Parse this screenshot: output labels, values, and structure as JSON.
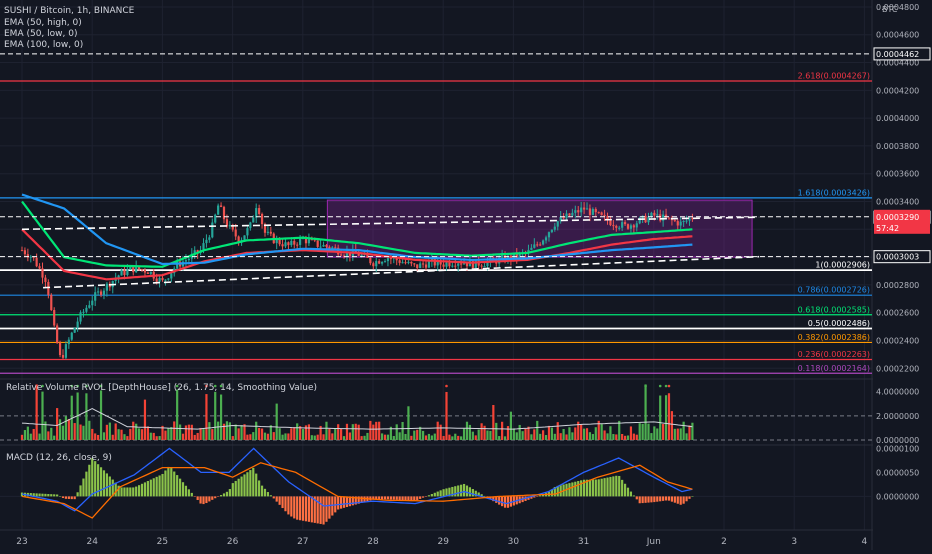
{
  "colors": {
    "background": "#131722",
    "grid": "#1e2230",
    "separator": "#2a2e39",
    "axis_text": "#b2b5be",
    "candle_up": "#26a69a",
    "candle_down": "#ef5350",
    "ema50_high": "#00e676",
    "ema50_low": "#f23645",
    "ema100_low": "#2196f3",
    "range_box": "#9c27b0",
    "vol_up": "#4caf50",
    "vol_down": "#f44336",
    "macd_line": "#2962ff",
    "signal_line": "#ff6d00"
  },
  "header": {
    "title": "SUSHI / Bitcoin, 1h, BINANCE",
    "indicators": [
      "EMA (50, high, 0)",
      "EMA (50, low, 0)",
      "EMA (100, low, 0)"
    ]
  },
  "price_axis": {
    "unit": "BTC",
    "ticks": [
      "0.0004800",
      "0.0004600",
      "0.0004400",
      "0.0004200",
      "0.0004000",
      "0.0003800",
      "0.0003600",
      "0.0003400",
      "0.0003200",
      "0.0003000",
      "0.0002800",
      "0.0002600",
      "0.0002400",
      "0.0002200"
    ],
    "last_price_label": "0.0003290",
    "countdown_label": "57:42",
    "boxed_labels": [
      "0.0004462",
      "0.0003287",
      "0.0003003"
    ]
  },
  "fib_levels": [
    {
      "label": "2.618(0.0004267)",
      "color": "#f23645"
    },
    {
      "label": "1.618(0.0003426)",
      "color": "#2196f3"
    },
    {
      "label": "1(0.0002906)",
      "color": "#ffffff"
    },
    {
      "label": "0.786(0.0002726)",
      "color": "#1e88e5"
    },
    {
      "label": "0.618(0.0002585)",
      "color": "#00e676"
    },
    {
      "label": "0.5(0.0002486)",
      "color": "#ffffff"
    },
    {
      "label": "0.382(0.0002386)",
      "color": "#ff9800"
    },
    {
      "label": "0.236(0.0002263)",
      "color": "#f23645"
    },
    {
      "label": "0.118(0.0002164)",
      "color": "#ab47bc"
    }
  ],
  "rvol": {
    "title": "Relative Volume RVOL [DepthHouse] (26, 1.75, 14, Smoothing Value)",
    "ticks": [
      "4.0000000",
      "2.0000000",
      "0.0000000"
    ]
  },
  "macd": {
    "title": "MACD (12, 26, close, 9)",
    "ticks": [
      "0.0000100",
      "0.0000050",
      "0.0000000"
    ]
  },
  "time_axis": {
    "labels": [
      "23",
      "24",
      "25",
      "26",
      "27",
      "28",
      "29",
      "30",
      "31",
      "Jun",
      "2",
      "3",
      "4"
    ]
  },
  "chart_data": {
    "type": "candlestick",
    "symbol": "SUSHI / Bitcoin",
    "interval": "1h",
    "exchange": "BINANCE",
    "y_unit": "BTC",
    "ylim": [
      0.000213,
      0.000485
    ],
    "x_categories": [
      "23",
      "24",
      "25",
      "26",
      "27",
      "28",
      "29",
      "30",
      "31",
      "Jun",
      "2",
      "3",
      "4"
    ],
    "last_price": 0.000329,
    "price_path": [
      [
        0,
        0.000305
      ],
      [
        0.15,
        0.0003
      ],
      [
        0.35,
        0.000283
      ],
      [
        0.45,
        0.00025
      ],
      [
        0.55,
        0.000226
      ],
      [
        0.65,
        0.000238
      ],
      [
        0.8,
        0.000255
      ],
      [
        1.0,
        0.00027
      ],
      [
        1.2,
        0.000279
      ],
      [
        1.4,
        0.000288
      ],
      [
        1.6,
        0.000292
      ],
      [
        1.8,
        0.00029
      ],
      [
        2.0,
        0.000282
      ],
      [
        2.2,
        0.000294
      ],
      [
        2.4,
        0.0003
      ],
      [
        2.55,
        0.000305
      ],
      [
        2.7,
        0.00032
      ],
      [
        2.8,
        0.000338
      ],
      [
        2.9,
        0.000325
      ],
      [
        3.0,
        0.000318
      ],
      [
        3.1,
        0.000312
      ],
      [
        3.25,
        0.000322
      ],
      [
        3.35,
        0.00034
      ],
      [
        3.45,
        0.000318
      ],
      [
        3.6,
        0.000312
      ],
      [
        3.8,
        0.000308
      ],
      [
        4.0,
        0.000313
      ],
      [
        4.2,
        0.000309
      ],
      [
        4.4,
        0.000307
      ],
      [
        4.6,
        0.000303
      ],
      [
        4.8,
        0.000302
      ],
      [
        5.0,
        0.000296
      ],
      [
        5.2,
        0.0003
      ],
      [
        5.4,
        0.000297
      ],
      [
        5.6,
        0.000293
      ],
      [
        5.8,
        0.000296
      ],
      [
        6.0,
        0.000295
      ],
      [
        6.2,
        0.000297
      ],
      [
        6.4,
        0.000295
      ],
      [
        6.6,
        0.000296
      ],
      [
        6.8,
        0.000298
      ],
      [
        7.0,
        0.0003
      ],
      [
        7.2,
        0.000303
      ],
      [
        7.4,
        0.000312
      ],
      [
        7.6,
        0.000325
      ],
      [
        7.8,
        0.00033
      ],
      [
        8.0,
        0.000335
      ],
      [
        8.2,
        0.00033
      ],
      [
        8.4,
        0.000325
      ],
      [
        8.6,
        0.000322
      ],
      [
        8.8,
        0.000326
      ],
      [
        9.0,
        0.00033
      ],
      [
        9.2,
        0.000327
      ],
      [
        9.4,
        0.000324
      ],
      [
        9.55,
        0.000329
      ]
    ],
    "ema_series": [
      {
        "name": "EMA (50, high, 0)",
        "values": [
          [
            0,
            0.00034
          ],
          [
            0.6,
            0.0003
          ],
          [
            1.2,
            0.000294
          ],
          [
            2.0,
            0.000293
          ],
          [
            2.6,
            0.000305
          ],
          [
            3.2,
            0.000312
          ],
          [
            4.0,
            0.000314
          ],
          [
            4.8,
            0.00031
          ],
          [
            5.6,
            0.000303
          ],
          [
            6.4,
            0.000301
          ],
          [
            7.2,
            0.000303
          ],
          [
            7.8,
            0.00031
          ],
          [
            8.4,
            0.000316
          ],
          [
            9.0,
            0.000318
          ],
          [
            9.55,
            0.00032
          ]
        ]
      },
      {
        "name": "EMA (50, low, 0)",
        "values": [
          [
            0,
            0.00032
          ],
          [
            0.6,
            0.00029
          ],
          [
            1.2,
            0.000284
          ],
          [
            2.0,
            0.000287
          ],
          [
            2.6,
            0.000297
          ],
          [
            3.2,
            0.000303
          ],
          [
            4.0,
            0.000305
          ],
          [
            4.8,
            0.000303
          ],
          [
            5.6,
            0.000298
          ],
          [
            6.4,
            0.000296
          ],
          [
            7.2,
            0.000298
          ],
          [
            7.8,
            0.000303
          ],
          [
            8.4,
            0.000309
          ],
          [
            9.0,
            0.000313
          ],
          [
            9.55,
            0.000315
          ]
        ]
      },
      {
        "name": "EMA (100, low, 0)",
        "values": [
          [
            0,
            0.000345
          ],
          [
            0.6,
            0.000335
          ],
          [
            1.2,
            0.00031
          ],
          [
            2.0,
            0.000295
          ],
          [
            2.6,
            0.000296
          ],
          [
            3.2,
            0.000302
          ],
          [
            4.0,
            0.000306
          ],
          [
            4.8,
            0.000305
          ],
          [
            5.6,
            0.0003
          ],
          [
            6.4,
            0.000298
          ],
          [
            7.2,
            0.000299
          ],
          [
            7.8,
            0.000302
          ],
          [
            8.4,
            0.000305
          ],
          [
            9.0,
            0.000307
          ],
          [
            9.55,
            0.000309
          ]
        ]
      }
    ],
    "horizontal_levels": [
      {
        "price": 0.0004462,
        "style": "dashed",
        "color": "#ffffff"
      },
      {
        "price": 0.000329,
        "style": "dashed",
        "color": "#ffffff"
      },
      {
        "price": 0.0003003,
        "style": "dashed",
        "color": "#ffffff"
      }
    ],
    "trend_lines": [
      {
        "style": "dashed",
        "color": "#ffffff",
        "from": [
          0,
          0.00032
        ],
        "to": [
          10.5,
          0.0003287
        ]
      },
      {
        "style": "dashed",
        "color": "#ffffff",
        "from": [
          0.3,
          0.000278
        ],
        "to": [
          10.5,
          0.0003003
        ]
      }
    ],
    "range_box": {
      "x0": 4.35,
      "x1": 10.4,
      "y_top": 0.000341,
      "y_bottom": 0.0003,
      "color": "#9c27b0"
    },
    "fibonacci": [
      {
        "ratio": 2.618,
        "price": 0.0004267
      },
      {
        "ratio": 1.618,
        "price": 0.0003426
      },
      {
        "ratio": 1,
        "price": 0.0002906
      },
      {
        "ratio": 0.786,
        "price": 0.0002726
      },
      {
        "ratio": 0.618,
        "price": 0.0002585
      },
      {
        "ratio": 0.5,
        "price": 0.0002486
      },
      {
        "ratio": 0.382,
        "price": 0.0002386
      },
      {
        "ratio": 0.236,
        "price": 0.0002263
      },
      {
        "ratio": 0.118,
        "price": 0.0002164
      }
    ],
    "rvol_series": {
      "ylim": [
        0,
        4.8
      ],
      "threshold_levels": [
        2.0
      ],
      "smoothing_line_points": [
        [
          0,
          1.4
        ],
        [
          0.5,
          1.2
        ],
        [
          1.0,
          2.6
        ],
        [
          1.5,
          1.1
        ],
        [
          2.5,
          0.9
        ],
        [
          3.0,
          1.2
        ],
        [
          4.0,
          1.0
        ],
        [
          5.0,
          0.9
        ],
        [
          6.0,
          1.0
        ],
        [
          7.0,
          0.9
        ],
        [
          8.0,
          1.3
        ],
        [
          9.0,
          1.5
        ],
        [
          9.55,
          1.1
        ]
      ]
    },
    "macd_series": {
      "ylim": [
        -7e-06,
        1.05e-05
      ],
      "macd_line": [
        [
          0,
          5e-07
        ],
        [
          0.5,
          -1e-06
        ],
        [
          0.75,
          -3e-06
        ],
        [
          1.0,
          5e-07
        ],
        [
          1.6,
          4.5e-06
        ],
        [
          2.1,
          1e-05
        ],
        [
          2.55,
          5e-06
        ],
        [
          2.95,
          5e-06
        ],
        [
          3.3,
          1e-05
        ],
        [
          3.8,
          3e-06
        ],
        [
          4.3,
          -2e-06
        ],
        [
          5.0,
          -1e-06
        ],
        [
          5.6,
          -1.5e-06
        ],
        [
          6.3,
          1e-06
        ],
        [
          6.9,
          -1.5e-06
        ],
        [
          7.5,
          1e-06
        ],
        [
          8.0,
          5e-06
        ],
        [
          8.5,
          8e-06
        ],
        [
          9.0,
          4e-06
        ],
        [
          9.4,
          1e-06
        ],
        [
          9.55,
          1.5e-06
        ]
      ],
      "signal_line": [
        [
          0,
          0.0
        ],
        [
          0.6,
          -1.5e-06
        ],
        [
          1.0,
          -4.5e-06
        ],
        [
          1.4,
          2e-06
        ],
        [
          2.0,
          6e-06
        ],
        [
          2.6,
          6e-06
        ],
        [
          3.0,
          4e-06
        ],
        [
          3.4,
          7e-06
        ],
        [
          3.9,
          5e-06
        ],
        [
          4.5,
          0.0
        ],
        [
          5.2,
          -8e-07
        ],
        [
          6.0,
          -1e-06
        ],
        [
          6.8,
          0.0
        ],
        [
          7.6,
          5e-07
        ],
        [
          8.2,
          4e-06
        ],
        [
          8.8,
          6.5e-06
        ],
        [
          9.2,
          3e-06
        ],
        [
          9.55,
          1.5e-06
        ]
      ]
    }
  }
}
